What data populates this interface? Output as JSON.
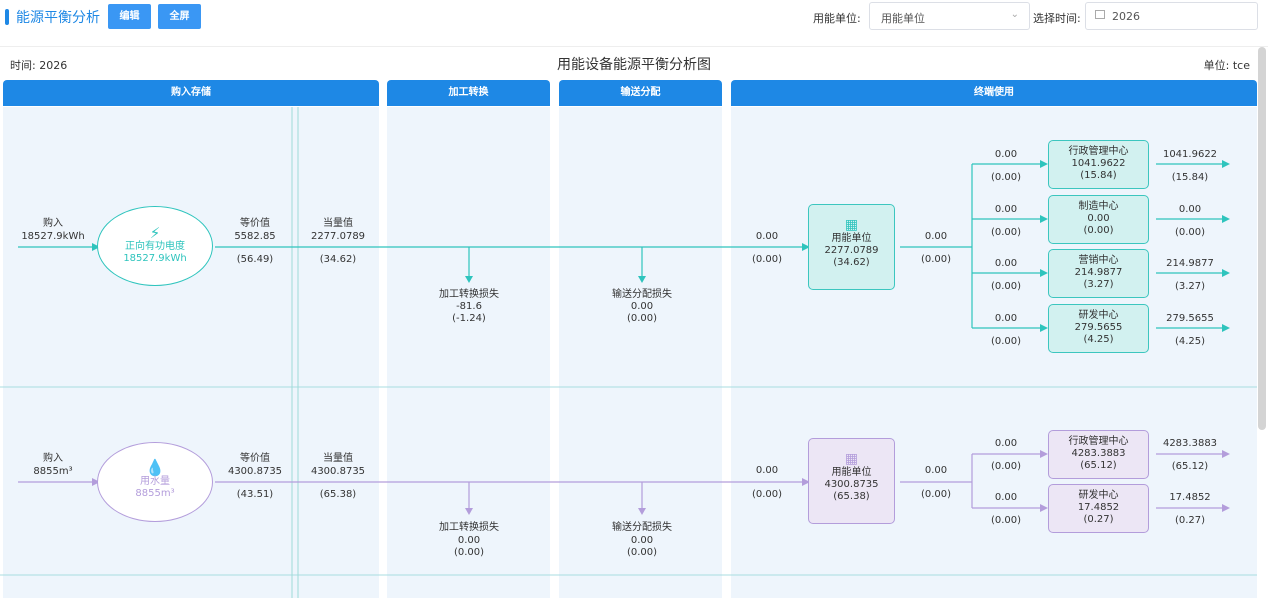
{
  "header": {
    "title": "能源平衡分析",
    "edit_label": "编辑",
    "fullscreen_label": "全屏",
    "unit_field_label": "用能单位:",
    "unit_select_value": "用能单位",
    "time_field_label": "选择时间:",
    "time_value": "2026"
  },
  "chart": {
    "time_label": "时间: 2026",
    "title": "用能设备能源平衡分析图",
    "unit_label": "单位: tce",
    "columns": [
      "购入存储",
      "加工转换",
      "输送分配",
      "终端使用"
    ]
  },
  "rows": [
    {
      "purchase_label": "购入",
      "purchase_value": "18527.9kWh",
      "source_name": "正向有功电度",
      "source_value": "18527.9kWh",
      "equiv_label": "等价值",
      "equiv_value": "5582.85",
      "equiv_pct": "(56.49)",
      "actual_label": "当量值",
      "actual_value": "2277.0789",
      "actual_pct": "(34.62)",
      "conv_loss_label": "加工转换损失",
      "conv_loss_value": "-81.6",
      "conv_loss_pct": "(-1.24)",
      "dist_loss_label": "输送分配损失",
      "dist_loss_value": "0.00",
      "dist_loss_pct": "(0.00)",
      "in_value": "0.00",
      "in_pct": "(0.00)",
      "unit_name": "用能单位",
      "unit_value": "2277.0789",
      "unit_pct": "(34.62)",
      "out_value": "0.00",
      "out_pct": "(0.00)",
      "centers": [
        {
          "branch_value": "0.00",
          "branch_pct": "(0.00)",
          "name": "行政管理中心",
          "value": "1041.9622",
          "pct": "(15.84)",
          "out_value": "1041.9622",
          "out_pct": "(15.84)"
        },
        {
          "branch_value": "0.00",
          "branch_pct": "(0.00)",
          "name": "制造中心",
          "value": "0.00",
          "pct": "(0.00)",
          "out_value": "0.00",
          "out_pct": "(0.00)"
        },
        {
          "branch_value": "0.00",
          "branch_pct": "(0.00)",
          "name": "营销中心",
          "value": "214.9877",
          "pct": "(3.27)",
          "out_value": "214.9877",
          "out_pct": "(3.27)"
        },
        {
          "branch_value": "0.00",
          "branch_pct": "(0.00)",
          "name": "研发中心",
          "value": "279.5655",
          "pct": "(4.25)",
          "out_value": "279.5655",
          "out_pct": "(4.25)"
        }
      ]
    },
    {
      "purchase_label": "购入",
      "purchase_value": "8855m³",
      "source_name": "用水量",
      "source_value": "8855m³",
      "equiv_label": "等价值",
      "equiv_value": "4300.8735",
      "equiv_pct": "(43.51)",
      "actual_label": "当量值",
      "actual_value": "4300.8735",
      "actual_pct": "(65.38)",
      "conv_loss_label": "加工转换损失",
      "conv_loss_value": "0.00",
      "conv_loss_pct": "(0.00)",
      "dist_loss_label": "输送分配损失",
      "dist_loss_value": "0.00",
      "dist_loss_pct": "(0.00)",
      "in_value": "0.00",
      "in_pct": "(0.00)",
      "unit_name": "用能单位",
      "unit_value": "4300.8735",
      "unit_pct": "(65.38)",
      "out_value": "0.00",
      "out_pct": "(0.00)",
      "centers": [
        {
          "branch_value": "0.00",
          "branch_pct": "(0.00)",
          "name": "行政管理中心",
          "value": "4283.3883",
          "pct": "(65.12)",
          "out_value": "4283.3883",
          "out_pct": "(65.12)"
        },
        {
          "branch_value": "0.00",
          "branch_pct": "(0.00)",
          "name": "研发中心",
          "value": "17.4852",
          "pct": "(0.27)",
          "out_value": "17.4852",
          "out_pct": "(0.27)"
        }
      ]
    }
  ],
  "colors": {
    "accent": "#1e88e5",
    "electric": "#2ec4bd",
    "water": "#b39ddb",
    "column_bg": "#eef5fc"
  },
  "icons": {
    "source_electric": "lightning-icon",
    "source_water": "water-drop-icon",
    "unit": "building-icon"
  }
}
